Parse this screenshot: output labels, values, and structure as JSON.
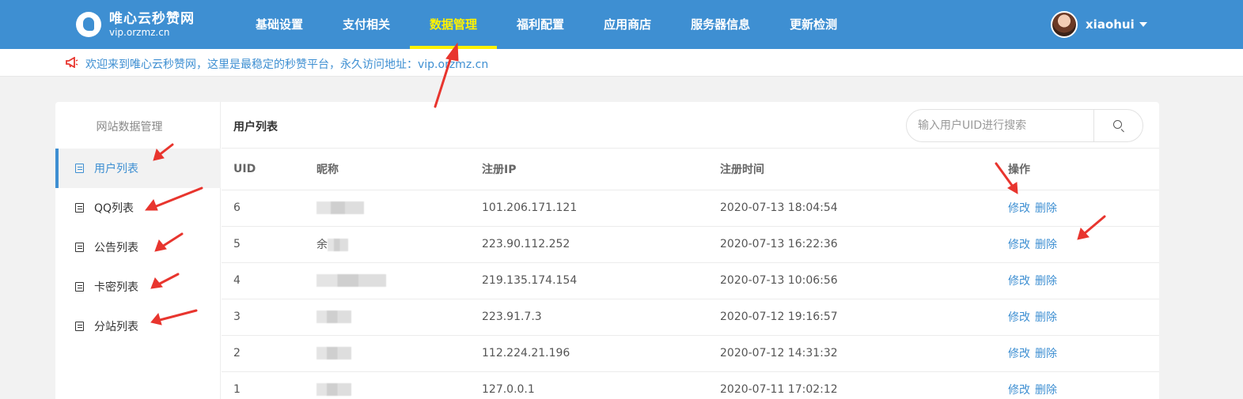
{
  "header": {
    "logo_title": "唯心云秒赞网",
    "logo_sub": "vip.orzmz.cn",
    "nav": [
      {
        "label": "基础设置",
        "active": false
      },
      {
        "label": "支付相关",
        "active": false
      },
      {
        "label": "数据管理",
        "active": true
      },
      {
        "label": "福利配置",
        "active": false
      },
      {
        "label": "应用商店",
        "active": false
      },
      {
        "label": "服务器信息",
        "active": false
      },
      {
        "label": "更新检测",
        "active": false
      }
    ],
    "username": "xiaohui"
  },
  "notice": {
    "text": "欢迎来到唯心云秒赞网，这里是最稳定的秒赞平台，永久访问地址：vip.orzmz.cn",
    "icon": "megaphone-icon"
  },
  "sidebar": {
    "title": "网站数据管理",
    "items": [
      {
        "label": "用户列表",
        "active": true
      },
      {
        "label": "QQ列表",
        "active": false
      },
      {
        "label": "公告列表",
        "active": false
      },
      {
        "label": "卡密列表",
        "active": false
      },
      {
        "label": "分站列表",
        "active": false
      }
    ]
  },
  "main": {
    "title": "用户列表",
    "search_placeholder": "输入用户UID进行搜索",
    "columns": [
      "UID",
      "昵称",
      "注册IP",
      "注册时间",
      "操作"
    ],
    "rows": [
      {
        "uid": "6",
        "nick": "",
        "ip": "101.206.171.121",
        "time": "2020-07-13 18:04:54"
      },
      {
        "uid": "5",
        "nick": "余",
        "ip": "223.90.112.252",
        "time": "2020-07-13 16:22:36"
      },
      {
        "uid": "4",
        "nick": "",
        "ip": "219.135.174.154",
        "time": "2020-07-13 10:06:56"
      },
      {
        "uid": "3",
        "nick": "",
        "ip": "223.91.7.3",
        "time": "2020-07-12 19:16:57"
      },
      {
        "uid": "2",
        "nick": "",
        "ip": "112.224.21.196",
        "time": "2020-07-12 14:31:32"
      },
      {
        "uid": "1",
        "nick": "",
        "ip": "127.0.0.1",
        "time": "2020-07-11 17:02:12"
      }
    ],
    "edit_label": "修改",
    "delete_label": "删除"
  },
  "colors": {
    "primary": "#3e8fd2",
    "active_nav": "#fff200",
    "annotation": "#e8352e"
  }
}
